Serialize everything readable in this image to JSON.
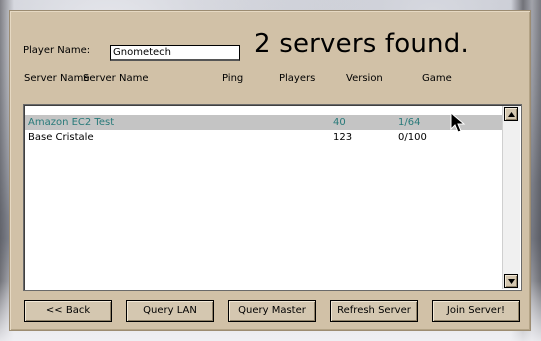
{
  "dialog": {
    "player_name_label": "Player Name:",
    "player_name_value": "Gnometech",
    "status_title": "2 servers found."
  },
  "columns": [
    "Server Name",
    "Server Name",
    "Ping",
    "Players",
    "Version",
    "Game"
  ],
  "servers": [
    {
      "name": "Amazon EC2 Test",
      "ping": "",
      "players": "",
      "version": "40",
      "game": "1/64",
      "selected": true
    },
    {
      "name": "Base Cristale",
      "ping": "",
      "players": "",
      "version": "123",
      "game": "0/100",
      "selected": false
    }
  ],
  "buttons": {
    "back": "<< Back",
    "query_lan": "Query LAN",
    "query_master": "Query Master",
    "refresh_server": "Refresh Server",
    "join_server": "Join Server!"
  },
  "colors": {
    "panel": "#d1c1a7",
    "selected_row_bg": "#c4c4c4",
    "selected_row_text": "#287a7a",
    "button_face": "#d4c7b0"
  },
  "icons": {
    "scroll_up": "triangle-up-icon",
    "scroll_down": "triangle-down-icon",
    "cursor": "mouse-pointer-icon"
  }
}
